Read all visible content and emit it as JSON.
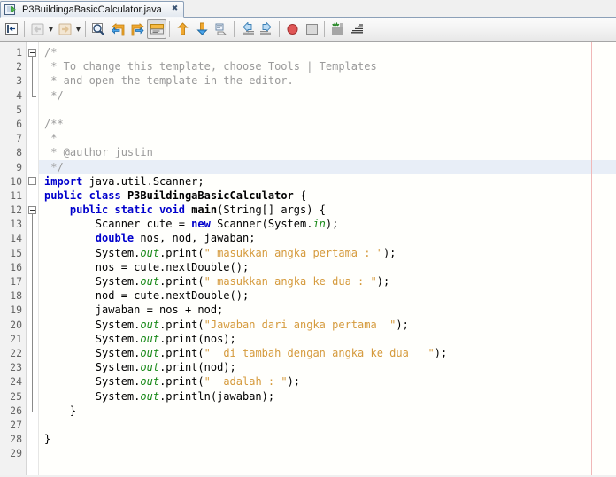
{
  "window": {
    "title": "P3BuildingaBasicCalculator.java",
    "app": "NetBeans IDE Java Editor"
  },
  "tab": {
    "label": "P3BuildingaBasicCalculator.java",
    "icon": "java-file-icon",
    "close_glyph": "✖"
  },
  "toolbar": {
    "buttons": [
      {
        "name": "toggle-rectangular-selection-button",
        "icon": "rect-select-icon",
        "enabled": true,
        "pressed": false,
        "dropdown": false
      },
      {
        "name": "back-button",
        "icon": "back-arrow-icon",
        "enabled": false,
        "pressed": false,
        "dropdown": true
      },
      {
        "name": "forward-button",
        "icon": "forward-arrow-icon",
        "enabled": false,
        "pressed": false,
        "dropdown": true
      },
      {
        "name": "find-selection-button",
        "icon": "magnifier-icon",
        "enabled": true,
        "pressed": false,
        "dropdown": false
      },
      {
        "name": "find-previous-button",
        "icon": "find-prev-icon",
        "enabled": true,
        "pressed": false,
        "dropdown": false
      },
      {
        "name": "find-next-button",
        "icon": "find-next-icon",
        "enabled": true,
        "pressed": false,
        "dropdown": false
      },
      {
        "name": "toggle-highlight-search-button",
        "icon": "highlight-icon",
        "enabled": true,
        "pressed": true,
        "dropdown": false
      },
      {
        "name": "previous-bookmark-button",
        "icon": "up-arrow-icon",
        "enabled": true,
        "pressed": false,
        "dropdown": false
      },
      {
        "name": "next-bookmark-button",
        "icon": "down-arrow-icon",
        "enabled": true,
        "pressed": false,
        "dropdown": false
      },
      {
        "name": "toggle-bookmark-button",
        "icon": "bookmark-icon",
        "enabled": true,
        "pressed": false,
        "dropdown": false
      },
      {
        "name": "shift-line-left-button",
        "icon": "shift-left-icon",
        "enabled": true,
        "pressed": false,
        "dropdown": false
      },
      {
        "name": "shift-line-right-button",
        "icon": "shift-right-icon",
        "enabled": true,
        "pressed": false,
        "dropdown": false
      },
      {
        "name": "stop-button",
        "icon": "stop-circle-icon",
        "enabled": true,
        "pressed": false,
        "dropdown": false
      },
      {
        "name": "comment-button",
        "icon": "comment-icon",
        "enabled": true,
        "pressed": false,
        "dropdown": false
      },
      {
        "name": "format-button",
        "icon": "format-icon",
        "enabled": true,
        "pressed": false,
        "dropdown": false
      },
      {
        "name": "uncomment-button",
        "icon": "uncomment-icon",
        "enabled": true,
        "pressed": false,
        "dropdown": false
      }
    ],
    "separators_after": [
      0,
      2,
      6,
      9,
      11,
      13
    ]
  },
  "editor": {
    "current_line": 9,
    "first_line": 1,
    "total_lines": 29,
    "colors": {
      "background": "#fffffc",
      "gutter_background": "#f2f2f2",
      "gutter_text": "#666666",
      "current_line_highlight": "#e8eef7",
      "right_margin": "#f0b8b8",
      "comment": "#9a9a9a",
      "keyword": "#0000cc",
      "string": "#d59a3c",
      "field": "#1a8a1a"
    },
    "folds": [
      {
        "start": 1,
        "end": 4
      },
      {
        "start": 10,
        "end": 10
      },
      {
        "start": 12,
        "end": 26
      }
    ],
    "lines": [
      {
        "n": 1,
        "tokens": [
          {
            "c": "cmt",
            "t": "/*"
          }
        ]
      },
      {
        "n": 2,
        "tokens": [
          {
            "c": "cmt",
            "t": " * To change this template, choose Tools | Templates"
          }
        ]
      },
      {
        "n": 3,
        "tokens": [
          {
            "c": "cmt",
            "t": " * and open the template in the editor."
          }
        ]
      },
      {
        "n": 4,
        "tokens": [
          {
            "c": "cmt",
            "t": " */"
          }
        ]
      },
      {
        "n": 5,
        "tokens": []
      },
      {
        "n": 6,
        "tokens": [
          {
            "c": "cmt",
            "t": "/**"
          }
        ]
      },
      {
        "n": 7,
        "tokens": [
          {
            "c": "cmt",
            "t": " *"
          }
        ]
      },
      {
        "n": 8,
        "tokens": [
          {
            "c": "cmt",
            "t": " * @author justin"
          }
        ]
      },
      {
        "n": 9,
        "tokens": [
          {
            "c": "cmt",
            "t": " */"
          }
        ]
      },
      {
        "n": 10,
        "tokens": [
          {
            "c": "kw",
            "t": "import"
          },
          {
            "c": "pln",
            "t": " java.util.Scanner;"
          }
        ]
      },
      {
        "n": 11,
        "tokens": [
          {
            "c": "kw",
            "t": "public class"
          },
          {
            "c": "pln",
            "t": " "
          },
          {
            "c": "cls",
            "t": "P3BuildingaBasicCalculator"
          },
          {
            "c": "pln",
            "t": " {"
          }
        ]
      },
      {
        "n": 12,
        "tokens": [
          {
            "c": "pln",
            "t": "    "
          },
          {
            "c": "kw",
            "t": "public static void"
          },
          {
            "c": "pln",
            "t": " "
          },
          {
            "c": "mth",
            "t": "main"
          },
          {
            "c": "pln",
            "t": "(String[] args) {"
          }
        ]
      },
      {
        "n": 13,
        "tokens": [
          {
            "c": "pln",
            "t": "        Scanner cute = "
          },
          {
            "c": "kw",
            "t": "new"
          },
          {
            "c": "pln",
            "t": " Scanner(System."
          },
          {
            "c": "fld",
            "t": "in"
          },
          {
            "c": "pln",
            "t": ");"
          }
        ]
      },
      {
        "n": 14,
        "tokens": [
          {
            "c": "pln",
            "t": "        "
          },
          {
            "c": "kw",
            "t": "double"
          },
          {
            "c": "pln",
            "t": " nos, nod, jawaban;"
          }
        ]
      },
      {
        "n": 15,
        "tokens": [
          {
            "c": "pln",
            "t": "        System."
          },
          {
            "c": "fld",
            "t": "out"
          },
          {
            "c": "pln",
            "t": ".print("
          },
          {
            "c": "str",
            "t": "\" masukkan angka pertama : \""
          },
          {
            "c": "pln",
            "t": ");"
          }
        ]
      },
      {
        "n": 16,
        "tokens": [
          {
            "c": "pln",
            "t": "        nos = cute.nextDouble();"
          }
        ]
      },
      {
        "n": 17,
        "tokens": [
          {
            "c": "pln",
            "t": "        System."
          },
          {
            "c": "fld",
            "t": "out"
          },
          {
            "c": "pln",
            "t": ".print("
          },
          {
            "c": "str",
            "t": "\" masukkan angka ke dua : \""
          },
          {
            "c": "pln",
            "t": ");"
          }
        ]
      },
      {
        "n": 18,
        "tokens": [
          {
            "c": "pln",
            "t": "        nod = cute.nextDouble();"
          }
        ]
      },
      {
        "n": 19,
        "tokens": [
          {
            "c": "pln",
            "t": "        jawaban = nos + nod;"
          }
        ]
      },
      {
        "n": 20,
        "tokens": [
          {
            "c": "pln",
            "t": "        System."
          },
          {
            "c": "fld",
            "t": "out"
          },
          {
            "c": "pln",
            "t": ".print("
          },
          {
            "c": "str",
            "t": "\"Jawaban dari angka pertama  \""
          },
          {
            "c": "pln",
            "t": ");"
          }
        ]
      },
      {
        "n": 21,
        "tokens": [
          {
            "c": "pln",
            "t": "        System."
          },
          {
            "c": "fld",
            "t": "out"
          },
          {
            "c": "pln",
            "t": ".print(nos);"
          }
        ]
      },
      {
        "n": 22,
        "tokens": [
          {
            "c": "pln",
            "t": "        System."
          },
          {
            "c": "fld",
            "t": "out"
          },
          {
            "c": "pln",
            "t": ".print("
          },
          {
            "c": "str",
            "t": "\"  di tambah dengan angka ke dua   \""
          },
          {
            "c": "pln",
            "t": ");"
          }
        ]
      },
      {
        "n": 23,
        "tokens": [
          {
            "c": "pln",
            "t": "        System."
          },
          {
            "c": "fld",
            "t": "out"
          },
          {
            "c": "pln",
            "t": ".print(nod);"
          }
        ]
      },
      {
        "n": 24,
        "tokens": [
          {
            "c": "pln",
            "t": "        System."
          },
          {
            "c": "fld",
            "t": "out"
          },
          {
            "c": "pln",
            "t": ".print("
          },
          {
            "c": "str",
            "t": "\"  adalah : \""
          },
          {
            "c": "pln",
            "t": ");"
          }
        ]
      },
      {
        "n": 25,
        "tokens": [
          {
            "c": "pln",
            "t": "        System."
          },
          {
            "c": "fld",
            "t": "out"
          },
          {
            "c": "pln",
            "t": ".println(jawaban);"
          }
        ]
      },
      {
        "n": 26,
        "tokens": [
          {
            "c": "pln",
            "t": "    }"
          }
        ]
      },
      {
        "n": 27,
        "tokens": []
      },
      {
        "n": 28,
        "tokens": [
          {
            "c": "pln",
            "t": "}"
          }
        ]
      },
      {
        "n": 29,
        "tokens": []
      }
    ]
  }
}
